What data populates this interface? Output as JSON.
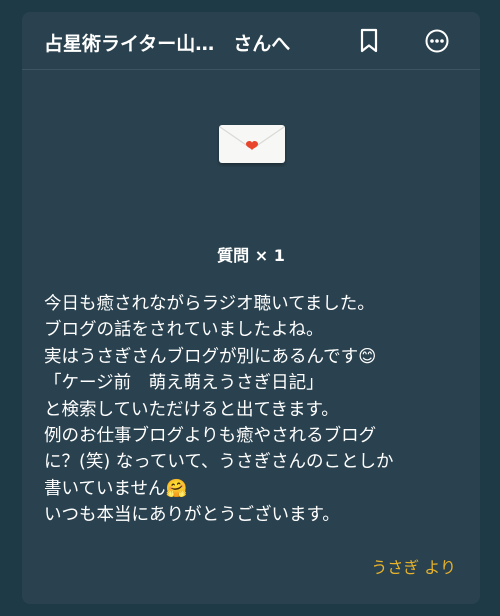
{
  "header": {
    "title": "占星術ライター山…　さんへ",
    "bookmark_icon": "bookmark-icon",
    "more_icon": "more-options-icon"
  },
  "envelope": {
    "icon": "envelope-heart-icon",
    "heart_color": "#e8452c"
  },
  "question": {
    "label": "質問 × 1"
  },
  "message": {
    "lines": [
      "今日も癒されながらラジオ聴いてました。",
      "ブログの話をされていましたよね。",
      "実はうさぎさんブログが別にあるんです😊",
      "「ケージ前　萌え萌えうさぎ日記」",
      "と検索していただけると出てきます。",
      "例のお仕事ブログよりも癒やされるブログ",
      "に？(笑) なっていて、うさぎさんのことしか",
      "書いていません🤗",
      "いつも本当にありがとうございます。"
    ]
  },
  "signature": {
    "text": "うさぎ より",
    "color": "#e8b32a"
  }
}
